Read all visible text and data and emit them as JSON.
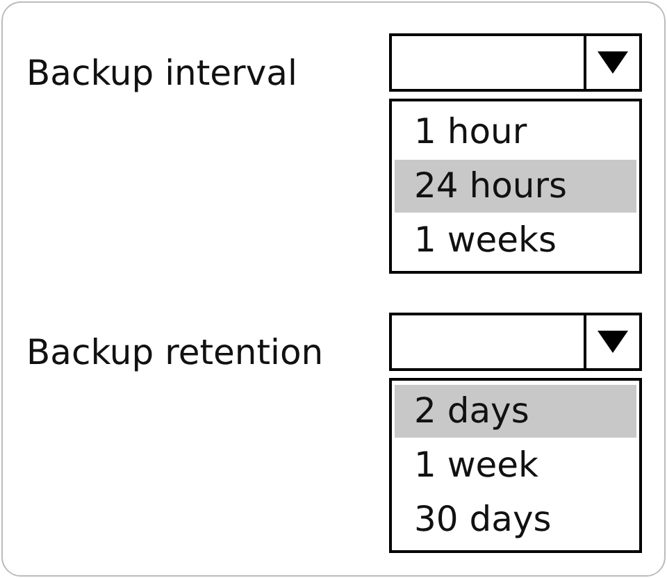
{
  "dropdowns": [
    {
      "label": "Backup interval",
      "options": [
        {
          "text": "1 hour",
          "selected": false
        },
        {
          "text": "24 hours",
          "selected": true
        },
        {
          "text": "1 weeks",
          "selected": false
        }
      ]
    },
    {
      "label": "Backup retention",
      "options": [
        {
          "text": "2 days",
          "selected": true
        },
        {
          "text": "1 week",
          "selected": false
        },
        {
          "text": "30 days",
          "selected": false
        }
      ]
    }
  ]
}
